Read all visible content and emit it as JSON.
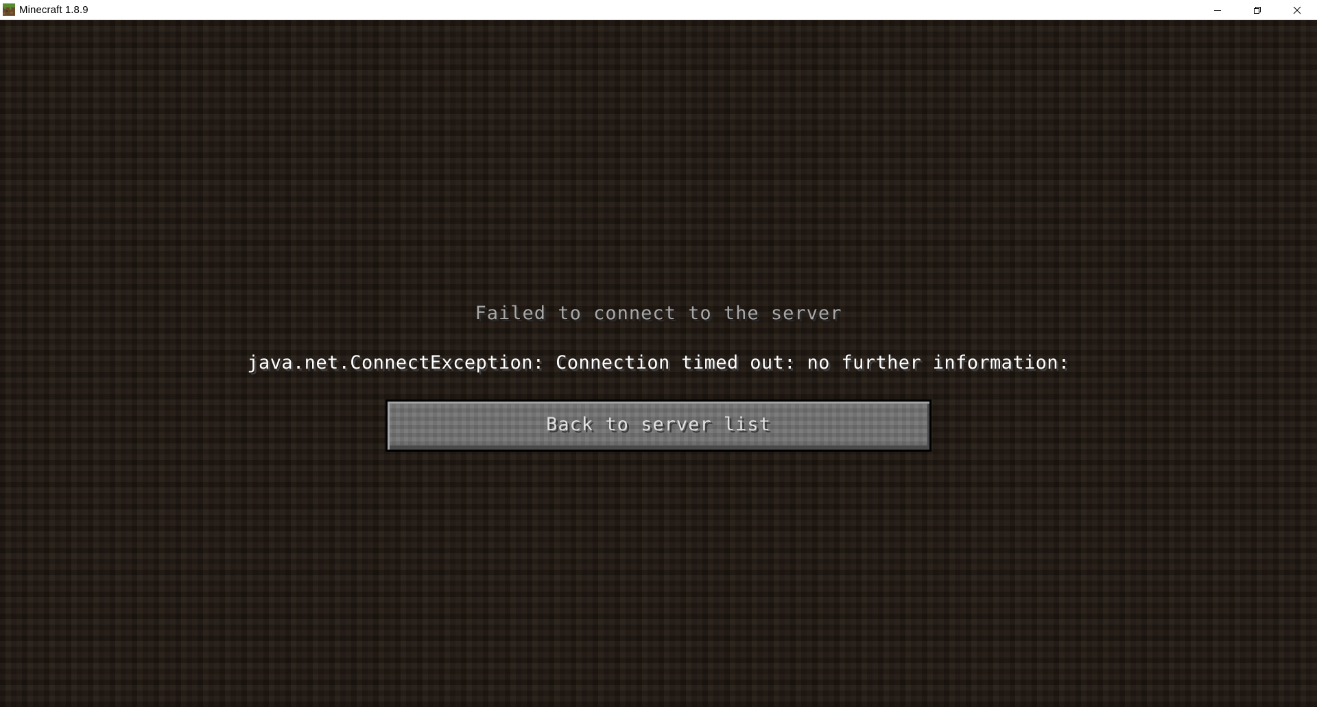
{
  "window": {
    "title": "Minecraft 1.8.9",
    "icon": "minecraft-grass-block-icon",
    "controls": {
      "minimize": "minimize-icon",
      "restore": "restore-icon",
      "close": "close-icon"
    }
  },
  "screen": {
    "heading": "Failed to connect to the server",
    "message": "java.net.ConnectException: Connection timed out: no further information:",
    "back_button_label": "Back to server list"
  },
  "colors": {
    "background": "#2d2219",
    "heading_text": "#a8a8a8",
    "message_text": "#ffffff",
    "button_face": "#6f6f6f",
    "button_text": "#e0e0e0"
  }
}
